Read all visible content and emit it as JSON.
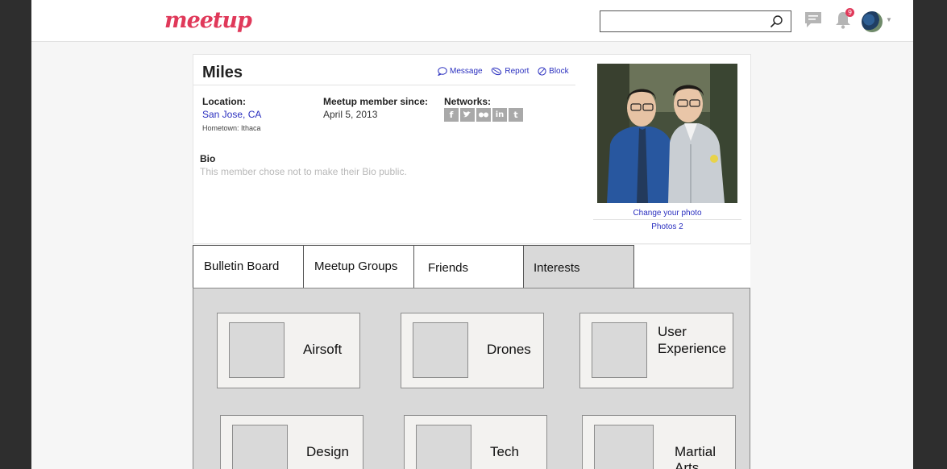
{
  "header": {
    "logo_text": "meetup",
    "search": {
      "value": "",
      "placeholder": ""
    },
    "notification_count": "9"
  },
  "profile": {
    "name": "Miles",
    "actions": {
      "message": "Message",
      "report": "Report",
      "block": "Block"
    },
    "location_label": "Location:",
    "location_value": "San Jose, CA",
    "hometown": "Hometown: Ithaca",
    "member_since_label": "Meetup member since:",
    "member_since_value": "April 5, 2013",
    "networks_label": "Networks:",
    "networks": [
      "facebook",
      "twitter",
      "flickr",
      "linkedin",
      "tumblr"
    ],
    "bio_label": "Bio",
    "bio_text": "This member chose not to make their Bio public.",
    "change_photo": "Change your photo",
    "photos_link": "Photos 2"
  },
  "tabs": [
    "Bulletin Board",
    "Meetup Groups",
    "Friends",
    "Interests"
  ],
  "active_tab": "Interests",
  "interests": [
    {
      "label_lines": [
        "Airsoft"
      ]
    },
    {
      "label_lines": [
        "Drones"
      ]
    },
    {
      "label_lines": [
        "User",
        "Experience"
      ]
    },
    {
      "label_lines": [
        "Design"
      ]
    },
    {
      "label_lines": [
        "Tech"
      ]
    },
    {
      "label_lines": [
        "Martial",
        "Arts"
      ]
    }
  ],
  "colors": {
    "brand": "#e0395a",
    "link": "#2a2fbf",
    "wireframe_gray": "#d9d9d9"
  }
}
